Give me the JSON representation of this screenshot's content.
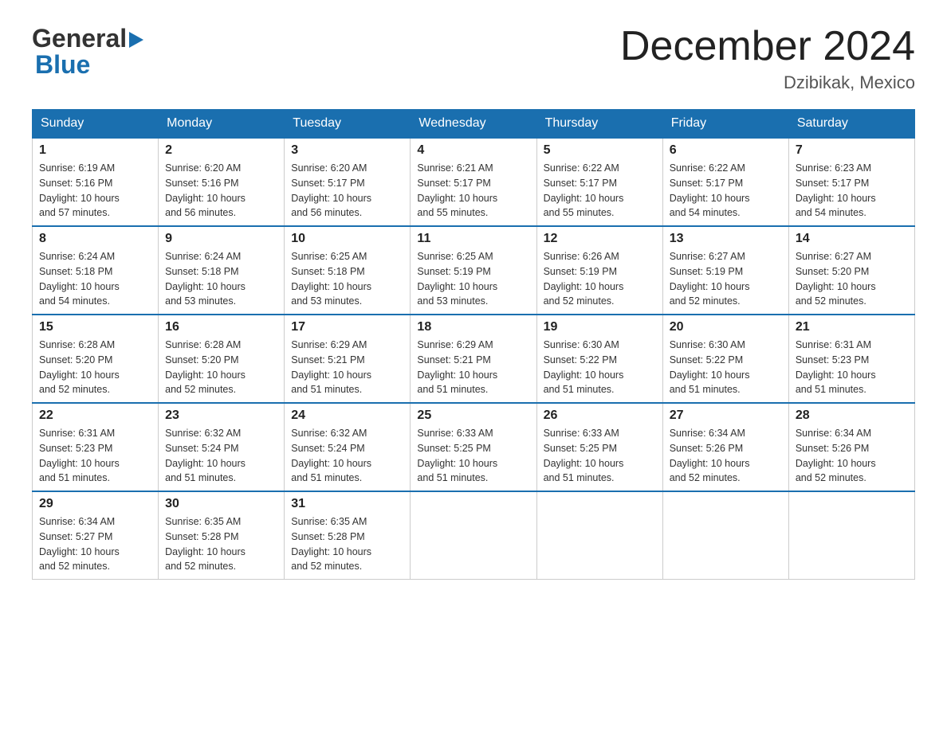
{
  "logo": {
    "line1": "General",
    "arrow": "▶",
    "line2": "Blue"
  },
  "title": "December 2024",
  "location": "Dzibikak, Mexico",
  "weekdays": [
    "Sunday",
    "Monday",
    "Tuesday",
    "Wednesday",
    "Thursday",
    "Friday",
    "Saturday"
  ],
  "weeks": [
    [
      {
        "day": "1",
        "sunrise": "6:19 AM",
        "sunset": "5:16 PM",
        "daylight": "10 hours and 57 minutes."
      },
      {
        "day": "2",
        "sunrise": "6:20 AM",
        "sunset": "5:16 PM",
        "daylight": "10 hours and 56 minutes."
      },
      {
        "day": "3",
        "sunrise": "6:20 AM",
        "sunset": "5:17 PM",
        "daylight": "10 hours and 56 minutes."
      },
      {
        "day": "4",
        "sunrise": "6:21 AM",
        "sunset": "5:17 PM",
        "daylight": "10 hours and 55 minutes."
      },
      {
        "day": "5",
        "sunrise": "6:22 AM",
        "sunset": "5:17 PM",
        "daylight": "10 hours and 55 minutes."
      },
      {
        "day": "6",
        "sunrise": "6:22 AM",
        "sunset": "5:17 PM",
        "daylight": "10 hours and 54 minutes."
      },
      {
        "day": "7",
        "sunrise": "6:23 AM",
        "sunset": "5:17 PM",
        "daylight": "10 hours and 54 minutes."
      }
    ],
    [
      {
        "day": "8",
        "sunrise": "6:24 AM",
        "sunset": "5:18 PM",
        "daylight": "10 hours and 54 minutes."
      },
      {
        "day": "9",
        "sunrise": "6:24 AM",
        "sunset": "5:18 PM",
        "daylight": "10 hours and 53 minutes."
      },
      {
        "day": "10",
        "sunrise": "6:25 AM",
        "sunset": "5:18 PM",
        "daylight": "10 hours and 53 minutes."
      },
      {
        "day": "11",
        "sunrise": "6:25 AM",
        "sunset": "5:19 PM",
        "daylight": "10 hours and 53 minutes."
      },
      {
        "day": "12",
        "sunrise": "6:26 AM",
        "sunset": "5:19 PM",
        "daylight": "10 hours and 52 minutes."
      },
      {
        "day": "13",
        "sunrise": "6:27 AM",
        "sunset": "5:19 PM",
        "daylight": "10 hours and 52 minutes."
      },
      {
        "day": "14",
        "sunrise": "6:27 AM",
        "sunset": "5:20 PM",
        "daylight": "10 hours and 52 minutes."
      }
    ],
    [
      {
        "day": "15",
        "sunrise": "6:28 AM",
        "sunset": "5:20 PM",
        "daylight": "10 hours and 52 minutes."
      },
      {
        "day": "16",
        "sunrise": "6:28 AM",
        "sunset": "5:20 PM",
        "daylight": "10 hours and 52 minutes."
      },
      {
        "day": "17",
        "sunrise": "6:29 AM",
        "sunset": "5:21 PM",
        "daylight": "10 hours and 51 minutes."
      },
      {
        "day": "18",
        "sunrise": "6:29 AM",
        "sunset": "5:21 PM",
        "daylight": "10 hours and 51 minutes."
      },
      {
        "day": "19",
        "sunrise": "6:30 AM",
        "sunset": "5:22 PM",
        "daylight": "10 hours and 51 minutes."
      },
      {
        "day": "20",
        "sunrise": "6:30 AM",
        "sunset": "5:22 PM",
        "daylight": "10 hours and 51 minutes."
      },
      {
        "day": "21",
        "sunrise": "6:31 AM",
        "sunset": "5:23 PM",
        "daylight": "10 hours and 51 minutes."
      }
    ],
    [
      {
        "day": "22",
        "sunrise": "6:31 AM",
        "sunset": "5:23 PM",
        "daylight": "10 hours and 51 minutes."
      },
      {
        "day": "23",
        "sunrise": "6:32 AM",
        "sunset": "5:24 PM",
        "daylight": "10 hours and 51 minutes."
      },
      {
        "day": "24",
        "sunrise": "6:32 AM",
        "sunset": "5:24 PM",
        "daylight": "10 hours and 51 minutes."
      },
      {
        "day": "25",
        "sunrise": "6:33 AM",
        "sunset": "5:25 PM",
        "daylight": "10 hours and 51 minutes."
      },
      {
        "day": "26",
        "sunrise": "6:33 AM",
        "sunset": "5:25 PM",
        "daylight": "10 hours and 51 minutes."
      },
      {
        "day": "27",
        "sunrise": "6:34 AM",
        "sunset": "5:26 PM",
        "daylight": "10 hours and 52 minutes."
      },
      {
        "day": "28",
        "sunrise": "6:34 AM",
        "sunset": "5:26 PM",
        "daylight": "10 hours and 52 minutes."
      }
    ],
    [
      {
        "day": "29",
        "sunrise": "6:34 AM",
        "sunset": "5:27 PM",
        "daylight": "10 hours and 52 minutes."
      },
      {
        "day": "30",
        "sunrise": "6:35 AM",
        "sunset": "5:28 PM",
        "daylight": "10 hours and 52 minutes."
      },
      {
        "day": "31",
        "sunrise": "6:35 AM",
        "sunset": "5:28 PM",
        "daylight": "10 hours and 52 minutes."
      },
      null,
      null,
      null,
      null
    ]
  ]
}
